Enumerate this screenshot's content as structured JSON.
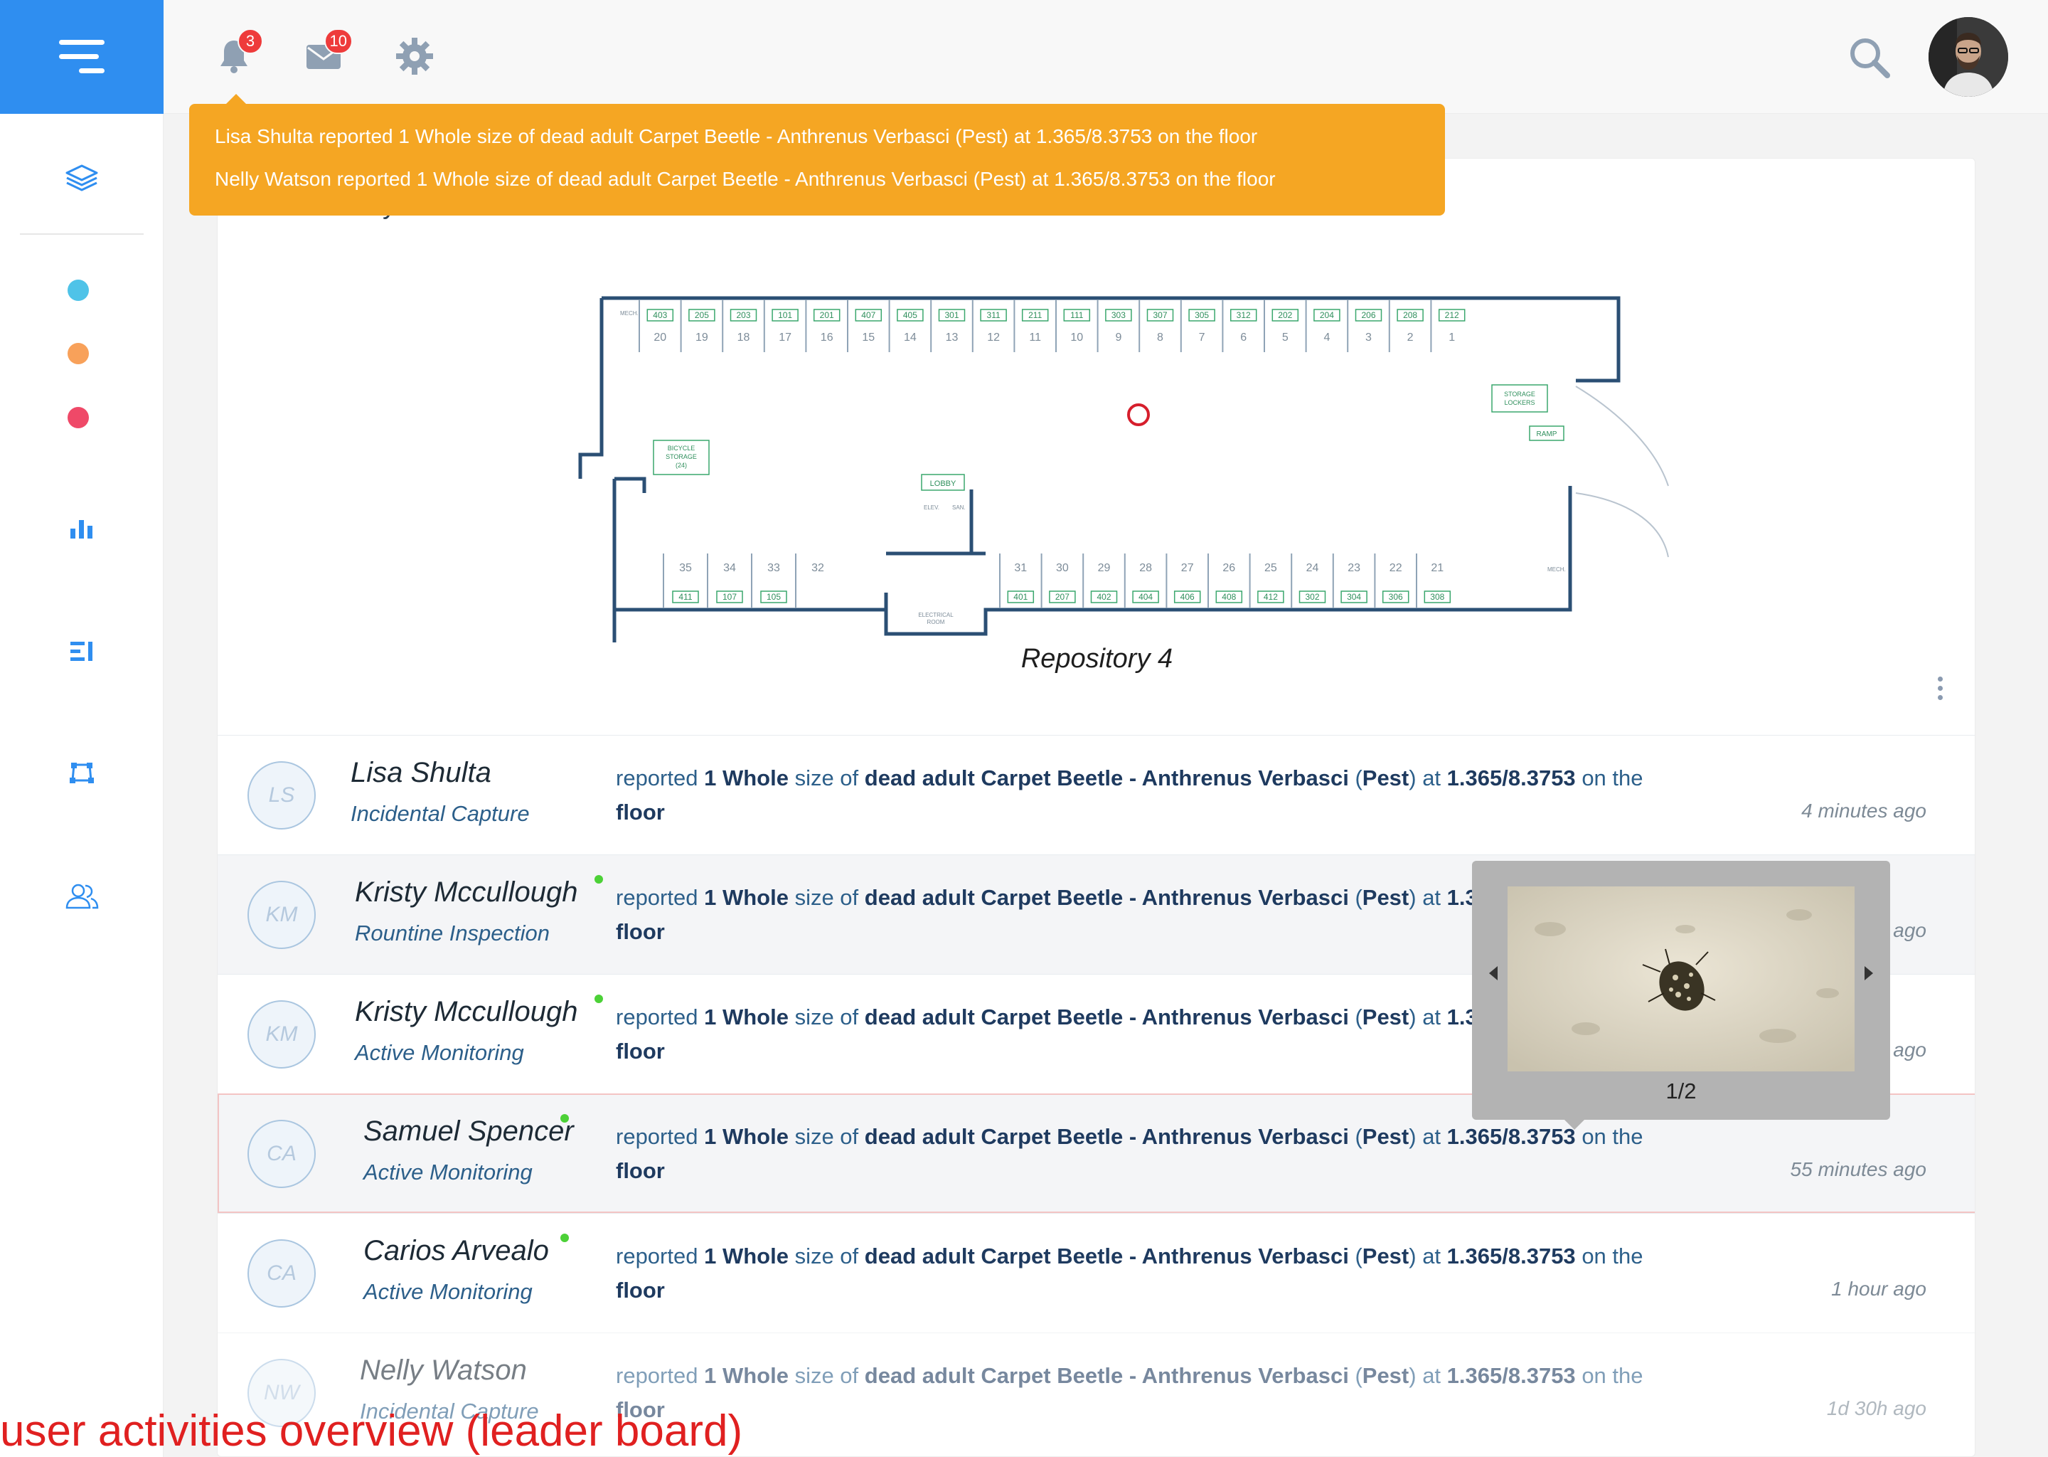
{
  "topbar": {
    "notifications_count": "3",
    "messages_count": "10"
  },
  "notifications": [
    "Lisa Shulta reported 1 Whole size of dead adult Carpet Beetle - Anthrenus Verbasci (Pest) at 1.365/8.3753 on the floor",
    "Nelly Watson reported 1 Whole size of dead adult Carpet Beetle - Anthrenus Verbasci (Pest) at 1.365/8.3753 on the floor"
  ],
  "card": {
    "title": "User Activity",
    "map_title": "Repository 4"
  },
  "sidebar": {
    "dot_colors": [
      "#4fc3e8",
      "#f8a15a",
      "#ef4968"
    ]
  },
  "floorplan": {
    "top_units": [
      "403",
      "205",
      "203",
      "101",
      "201",
      "407",
      "405",
      "301",
      "311",
      "211",
      "111",
      "303",
      "307",
      "305",
      "312",
      "202",
      "204",
      "206",
      "208",
      "212"
    ],
    "top_numbers": [
      "20",
      "19",
      "18",
      "17",
      "16",
      "15",
      "14",
      "13",
      "12",
      "11",
      "10",
      "9",
      "8",
      "7",
      "6",
      "5",
      "4",
      "3",
      "2",
      "1"
    ],
    "left_bottom_numbers": [
      "35",
      "34",
      "33",
      "32"
    ],
    "left_bottom_units": [
      "411",
      "107",
      "105"
    ],
    "right_bottom_numbers": [
      "31",
      "30",
      "29",
      "28",
      "27",
      "26",
      "25",
      "24",
      "23",
      "22",
      "21"
    ],
    "right_bottom_units": [
      "401",
      "207",
      "402",
      "404",
      "406",
      "408",
      "412",
      "302",
      "304",
      "306",
      "308"
    ],
    "labels": {
      "bicycle": [
        "BICYCLE",
        "STORAGE",
        "(24)"
      ],
      "lobby": "LOBBY",
      "elev": "ELEV.",
      "san": "SAN.",
      "electrical": [
        "ELECTRICAL",
        "ROOM"
      ],
      "storage": [
        "STORAGE",
        "LOCKERS"
      ],
      "ramp": "RAMP",
      "mech": "MECH."
    }
  },
  "activities": [
    {
      "initials": "LS",
      "name": "Lisa Shulta",
      "role": "Incidental Capture",
      "online": false,
      "time": "4 minutes ago"
    },
    {
      "initials": "KM",
      "name": "Kristy Mccullough",
      "role": "Rountine Inspection",
      "online": true,
      "time": "ago"
    },
    {
      "initials": "KM",
      "name": "Kristy Mccullough",
      "role": "Active Monitoring",
      "online": true,
      "time": "ago"
    },
    {
      "initials": "CA",
      "name": "Samuel Spencer",
      "role": "Active Monitoring",
      "online": true,
      "time": "55 minutes ago"
    },
    {
      "initials": "CA",
      "name": "Carios Arvealo",
      "role": "Active Monitoring",
      "online": true,
      "time": "1 hour ago"
    },
    {
      "initials": "NW",
      "name": "Nelly Watson",
      "role": "Incidental Capture",
      "online": false,
      "time": "1d 30h ago"
    }
  ],
  "activity_text": {
    "reported": "reported",
    "quantity": "1 Whole",
    "size_of": "size of",
    "species": "dead adult Carpet Beetle - Anthrenus Verbasci",
    "category": "Pest",
    "at": "at",
    "coords": "1.365/8.3753",
    "on_the": "on the",
    "location": "floor"
  },
  "popup": {
    "counter": "1/2"
  },
  "caption": "user activities overview (leader board)"
}
